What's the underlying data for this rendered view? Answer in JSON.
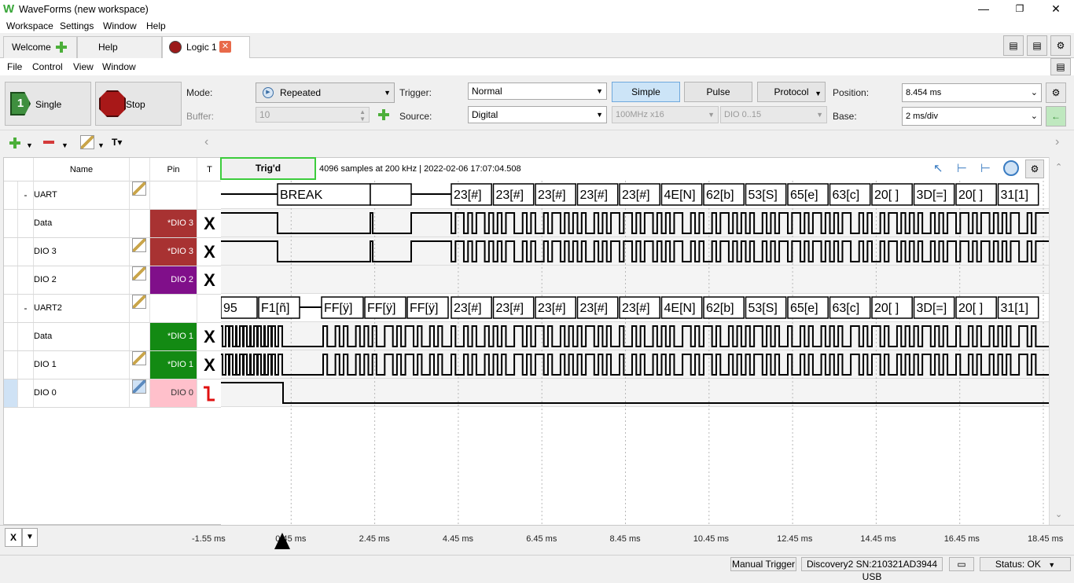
{
  "window": {
    "title": "WaveForms (new workspace)"
  },
  "menu_main": [
    "Workspace",
    "Settings",
    "Window",
    "Help"
  ],
  "tabs": [
    {
      "label": "Welcome"
    },
    {
      "label": "Help"
    },
    {
      "label": "Logic 1",
      "active": true
    }
  ],
  "menu_logic": [
    "File",
    "Control",
    "View",
    "Window"
  ],
  "toolbar": {
    "single_label": "Single",
    "stop_label": "Stop",
    "mode_label": "Mode:",
    "mode_value": "Repeated",
    "buffer_label": "Buffer:",
    "buffer_value": "10",
    "trigger_label": "Trigger:",
    "trigger_value": "Normal",
    "source_label": "Source:",
    "source_value": "Digital",
    "simple_label": "Simple",
    "pulse_label": "Pulse",
    "protocol_label": "Protocol",
    "rate_value": "100MHz x16",
    "dio_range_value": "DIO 0..15",
    "position_label": "Position:",
    "position_value": "8.454 ms",
    "base_label": "Base:",
    "base_value": "2 ms/div",
    "format_icon_text": "T▾"
  },
  "columns": {
    "name": "Name",
    "pin": "Pin",
    "t": "T"
  },
  "signals": [
    {
      "expander": "-",
      "name": "UART",
      "pin": "",
      "pin_color": "",
      "trigger": "",
      "editable": true,
      "bus": true
    },
    {
      "expander": "",
      "name": "Data",
      "pin": "*DIO 3",
      "pin_color": "#a83232",
      "trigger": "X",
      "editable": false,
      "bus": false
    },
    {
      "expander": "",
      "name": "DIO 3",
      "pin": "*DIO 3",
      "pin_color": "#a83232",
      "trigger": "X",
      "editable": true,
      "bus": false
    },
    {
      "expander": "",
      "name": "DIO 2",
      "pin": "DIO 2",
      "pin_color": "#800f8a",
      "trigger": "X",
      "editable": true,
      "bus": false
    },
    {
      "expander": "-",
      "name": "UART2",
      "pin": "",
      "pin_color": "",
      "trigger": "",
      "editable": true,
      "bus": true
    },
    {
      "expander": "",
      "name": "Data",
      "pin": "*DIO 1",
      "pin_color": "#138a13",
      "trigger": "X",
      "editable": false,
      "bus": false
    },
    {
      "expander": "",
      "name": "DIO 1",
      "pin": "*DIO 1",
      "pin_color": "#138a13",
      "trigger": "X",
      "editable": true,
      "bus": false
    },
    {
      "expander": "",
      "name": "DIO 0",
      "pin": "DIO 0",
      "pin_color": "#ffc0cb",
      "trigger": "fall-edge",
      "editable": true,
      "bus": false,
      "selected": true
    }
  ],
  "status_header": {
    "trig_state": "Trig'd",
    "info": "4096 samples at 200 kHz | 2022-02-06 17:07:04.508"
  },
  "uart1_bus": [
    "BREAK",
    "",
    "23[#]",
    "23[#]",
    "23[#]",
    "23[#]",
    "23[#]",
    "4E[N]",
    "62[b]",
    "53[S]",
    "65[e]",
    "63[c]",
    "20[ ]",
    "3D[=]",
    "20[ ]",
    "31[1]"
  ],
  "uart2_bus": [
    "95",
    "F1[ñ]",
    "FF[ÿ]",
    "FF[ÿ]",
    "FF[ÿ]",
    "23[#]",
    "23[#]",
    "23[#]",
    "23[#]",
    "23[#]",
    "4E[N]",
    "62[b]",
    "53[S]",
    "65[e]",
    "63[c]",
    "20[ ]",
    "3D[=]",
    "20[ ]",
    "31[1]"
  ],
  "time_axis": {
    "axis_button": "X",
    "ticks": [
      "-1.55 ms",
      "0.45 ms",
      "2.45 ms",
      "4.45 ms",
      "6.45 ms",
      "8.45 ms",
      "10.45 ms",
      "12.45 ms",
      "14.45 ms",
      "16.45 ms",
      "18.45 ms"
    ]
  },
  "statusbar": {
    "manual_trigger": "Manual Trigger",
    "device": "Discovery2 SN:210321AD3944 USB",
    "status": "Status: OK"
  }
}
